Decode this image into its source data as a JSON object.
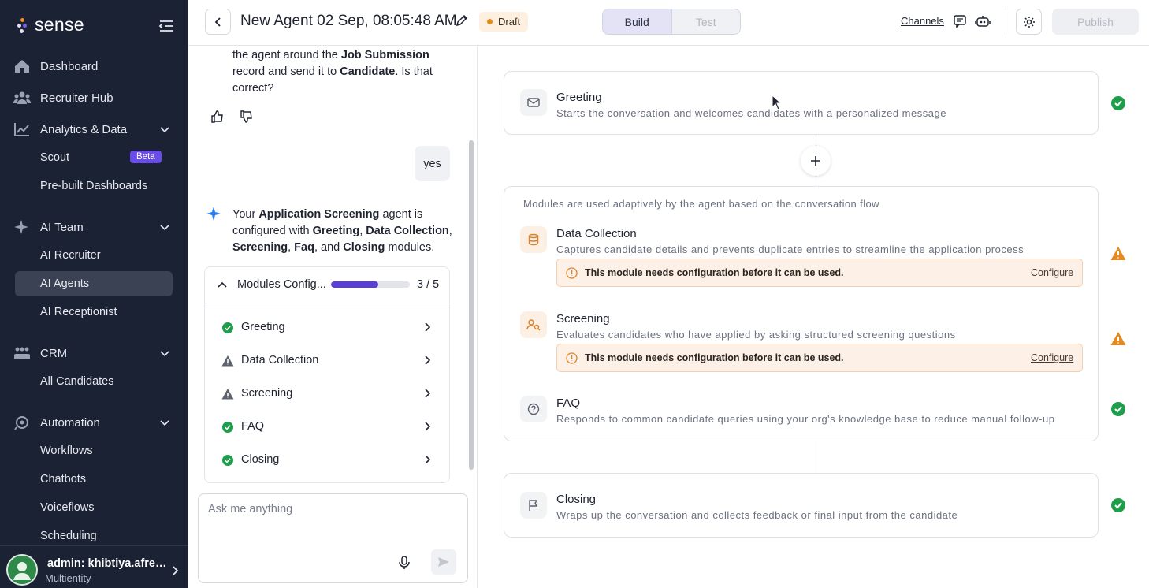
{
  "app": {
    "logo_text": "sense",
    "colors": {
      "sidebar_bg": "#1a2234",
      "accent": "#5a3fd6",
      "success": "#1e9e4a",
      "warning": "#e58a1e"
    }
  },
  "sidebar": {
    "nav": {
      "dashboard": "Dashboard",
      "recruiter_hub": "Recruiter Hub",
      "analytics": "Analytics & Data",
      "scout": "Scout",
      "scout_badge": "Beta",
      "prebuilt": "Pre-built Dashboards",
      "ai_team": "AI Team",
      "ai_recruiter": "AI Recruiter",
      "ai_agents": "AI Agents",
      "ai_receptionist": "AI Receptionist",
      "crm": "CRM",
      "all_candidates": "All Candidates",
      "automation": "Automation",
      "workflows": "Workflows",
      "chatbots": "Chatbots",
      "voiceflows": "Voiceflows",
      "scheduling": "Scheduling"
    },
    "user": {
      "name": "admin: khibtiya.afree...",
      "org": "Multientity"
    }
  },
  "header": {
    "title": "New Agent 02 Sep, 08:05:48 AM",
    "status": "Draft",
    "tabs": {
      "build": "Build",
      "test": "Test"
    },
    "channels": "Channels",
    "publish": "Publish"
  },
  "chat": {
    "msg1": {
      "a": "the agent around the ",
      "b": "Job Submission",
      "c": " record and send it to ",
      "d": "Candidate",
      "e": ". Is that correct?"
    },
    "user_reply": "yes",
    "msg2": {
      "a": "Your ",
      "b": "Application Screening",
      "c": " agent is configured with ",
      "d": "Greeting",
      "e": ", ",
      "f": "Data Collection",
      "g": ", ",
      "h": "Screening",
      "i": ", ",
      "j": "Faq",
      "k": ", and ",
      "l": "Closing",
      "m": " modules."
    },
    "modules_card": {
      "title": "Modules Config...",
      "count": "3 / 5",
      "progress": 0.6,
      "items": [
        {
          "name": "Greeting",
          "status": "done"
        },
        {
          "name": "Data Collection",
          "status": "warning"
        },
        {
          "name": "Screening",
          "status": "warning"
        },
        {
          "name": "FAQ",
          "status": "done"
        },
        {
          "name": "Closing",
          "status": "done"
        }
      ]
    },
    "composer_placeholder": "Ask me anything"
  },
  "canvas": {
    "greeting": {
      "title": "Greeting",
      "desc": "Starts the conversation and welcomes candidates with a personalized message"
    },
    "adaptive_note": "Modules are used adaptively by the agent based on the conversation flow",
    "data_collection": {
      "title": "Data Collection",
      "desc": "Captures candidate details and prevents duplicate entries to streamline the application process"
    },
    "screening": {
      "title": "Screening",
      "desc": "Evaluates candidates who have applied by asking structured screening questions"
    },
    "faq": {
      "title": "FAQ",
      "desc": "Responds to common candidate queries using your org's knowledge base to reduce manual follow-up"
    },
    "closing": {
      "title": "Closing",
      "desc": "Wraps up the conversation and collects feedback or final input from the candidate"
    },
    "warning_text": "This module needs configuration before it can be used.",
    "configure": "Configure"
  }
}
